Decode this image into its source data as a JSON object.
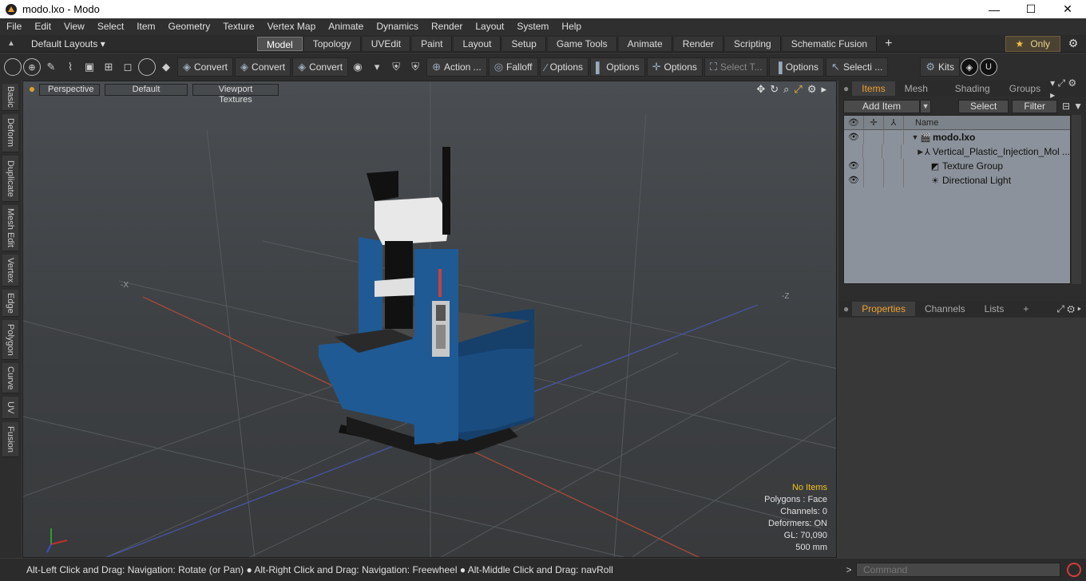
{
  "window": {
    "title": "modo.lxo - Modo",
    "minimize": "—",
    "maximize": "☐",
    "close": "✕"
  },
  "menu": [
    "File",
    "Edit",
    "View",
    "Select",
    "Item",
    "Geometry",
    "Texture",
    "Vertex Map",
    "Animate",
    "Dynamics",
    "Render",
    "Layout",
    "System",
    "Help"
  ],
  "layouts": {
    "label": "Default Layouts ▾"
  },
  "tabs": [
    {
      "label": "Model",
      "active": true
    },
    {
      "label": "Topology"
    },
    {
      "label": "UVEdit"
    },
    {
      "label": "Paint"
    },
    {
      "label": "Layout"
    },
    {
      "label": "Setup"
    },
    {
      "label": "Game Tools"
    },
    {
      "label": "Animate"
    },
    {
      "label": "Render"
    },
    {
      "label": "Scripting"
    },
    {
      "label": "Schematic Fusion"
    }
  ],
  "tab_plus": "+",
  "only": {
    "label": "Only"
  },
  "toolbar": {
    "convert1": "Convert",
    "convert2": "Convert",
    "convert3": "Convert",
    "action": "Action ...",
    "falloff": "Falloff",
    "options1": "Options",
    "options2": "Options",
    "options3": "Options",
    "select_t": "Select T...",
    "options4": "Options",
    "selecti": "Selecti ...",
    "kits": "Kits"
  },
  "left_tabs": [
    "Basic",
    "Deform",
    "Duplicate",
    "Mesh Edit",
    "Vertex",
    "Edge",
    "Polygon",
    "Curve",
    "UV",
    "Fusion"
  ],
  "viewport": {
    "perspective": "Perspective",
    "default": "Default",
    "textures": "Viewport Textures",
    "axis_x": "-X",
    "axis_z": "-Z",
    "stats": {
      "no_items": "No Items",
      "polygons": "Polygons : Face",
      "channels": "Channels: 0",
      "deformers": "Deformers: ON",
      "gl": "GL: 70,090",
      "scale": "500 mm"
    }
  },
  "status": {
    "hint": "Alt-Left Click and Drag: Navigation: Rotate (or Pan) ● Alt-Right Click and Drag: Navigation: Freewheel ● Alt-Middle Click and Drag: navRoll",
    "command_placeholder": "Command",
    "prompt": ">"
  },
  "items_panel": {
    "tabs": [
      "Items",
      "Mesh ...",
      "Shading",
      "Groups"
    ],
    "add_item": "Add Item",
    "select": "Select",
    "filter": "Filter",
    "name_header": "Name",
    "rows": [
      {
        "name": "modo.lxo",
        "bold": true,
        "eye": "👁",
        "tri": "▼"
      },
      {
        "name": "Vertical_Plastic_Injection_Mol ...",
        "eye": "",
        "tri": "▶"
      },
      {
        "name": "Texture Group",
        "eye": "👁",
        "tri": ""
      },
      {
        "name": "Directional Light",
        "eye": "👁",
        "tri": ""
      }
    ]
  },
  "props_panel": {
    "tabs": [
      "Properties",
      "Channels",
      "Lists"
    ],
    "plus": "+"
  },
  "colors": {
    "accent": "#f0a030",
    "machine_blue": "#1f5a94",
    "background": "#3a3a3a"
  }
}
